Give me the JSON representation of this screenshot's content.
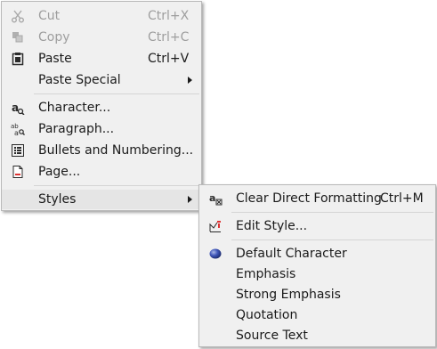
{
  "context_menu": {
    "items": [
      {
        "label": "Cut",
        "shortcut": "Ctrl+X",
        "icon": "cut-icon",
        "enabled": false
      },
      {
        "label": "Copy",
        "shortcut": "Ctrl+C",
        "icon": "copy-icon",
        "enabled": false
      },
      {
        "label": "Paste",
        "shortcut": "Ctrl+V",
        "icon": "paste-icon",
        "enabled": true
      },
      {
        "label": "Paste Special",
        "submenu": true,
        "enabled": true
      },
      {
        "label": "Character...",
        "icon": "character-icon",
        "enabled": true
      },
      {
        "label": "Paragraph...",
        "icon": "paragraph-icon",
        "enabled": true
      },
      {
        "label": "Bullets and Numbering...",
        "icon": "bullets-icon",
        "enabled": true
      },
      {
        "label": "Page...",
        "icon": "page-icon",
        "enabled": true
      },
      {
        "label": "Styles",
        "submenu": true,
        "enabled": true,
        "highlighted": true
      }
    ]
  },
  "styles_submenu": {
    "items": [
      {
        "label": "Clear Direct Formatting",
        "shortcut": "Ctrl+M",
        "icon": "clear-formatting-icon"
      },
      {
        "label": "Edit Style...",
        "icon": "edit-style-icon"
      },
      {
        "label": "Default Character",
        "icon": "selected-bullet-icon"
      },
      {
        "label": "Emphasis"
      },
      {
        "label": "Strong Emphasis"
      },
      {
        "label": "Quotation"
      },
      {
        "label": "Source Text"
      }
    ]
  }
}
